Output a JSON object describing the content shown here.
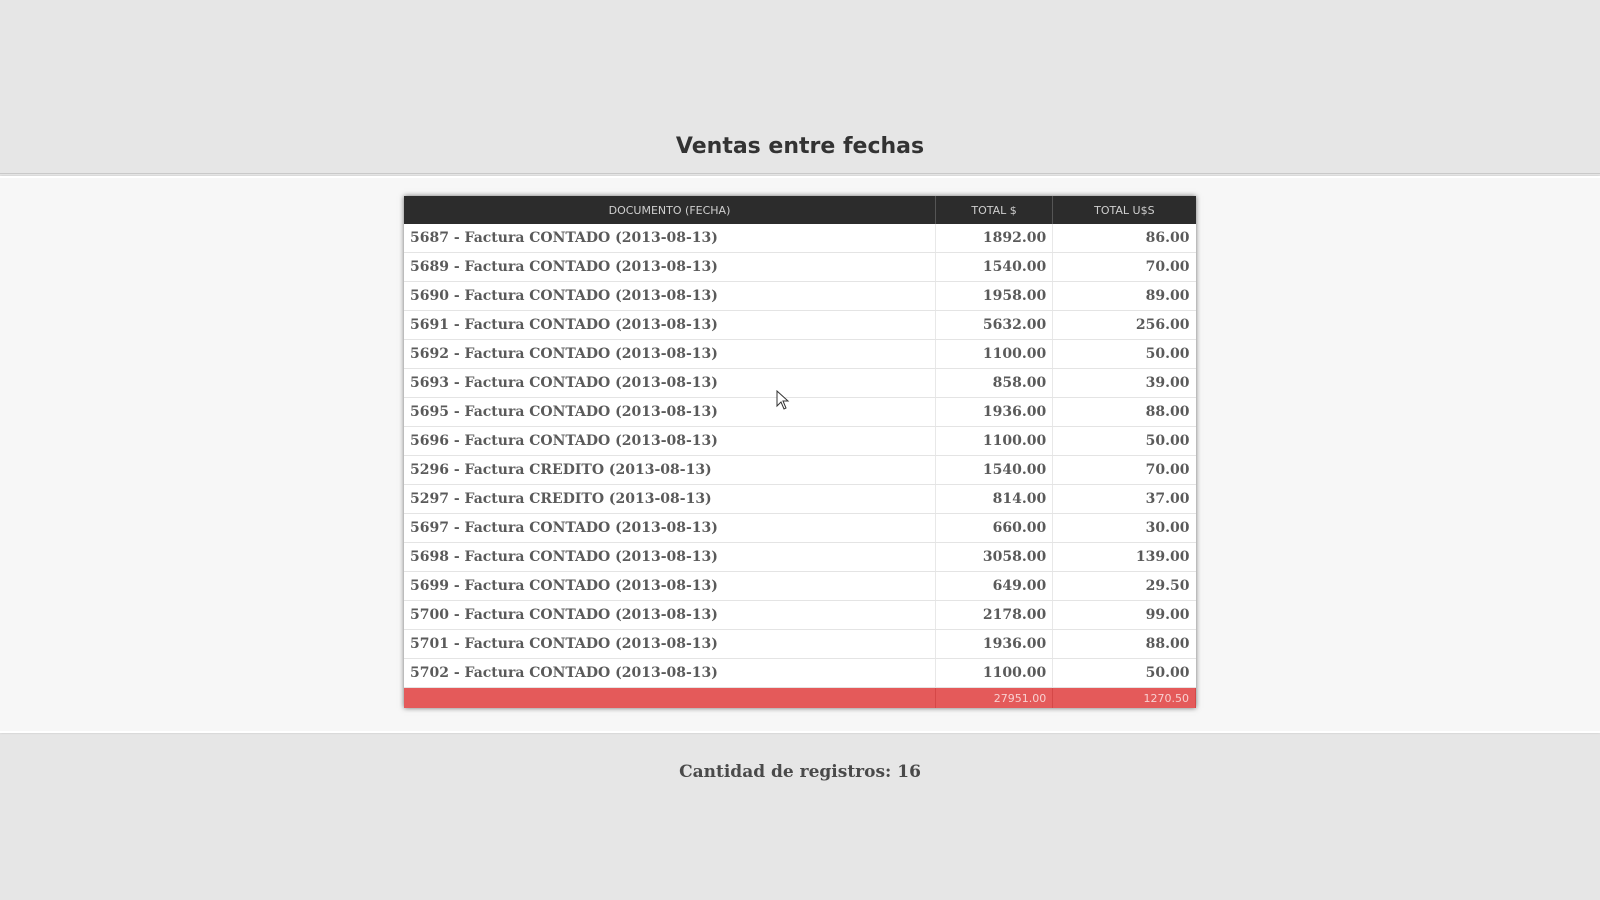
{
  "page": {
    "title": "Ventas entre fechas",
    "records_count": "Cantidad de registros: 16"
  },
  "table": {
    "headers": [
      "DOCUMENTO (FECHA)",
      "TOTAL $",
      "TOTAL U$S"
    ],
    "rows": [
      {
        "documento": "5687 - Factura CONTADO (2013-08-13)",
        "total_pesos": "1892.00",
        "total_usd": "86.00"
      },
      {
        "documento": "5689 - Factura CONTADO (2013-08-13)",
        "total_pesos": "1540.00",
        "total_usd": "70.00"
      },
      {
        "documento": "5690 - Factura CONTADO (2013-08-13)",
        "total_pesos": "1958.00",
        "total_usd": "89.00"
      },
      {
        "documento": "5691 - Factura CONTADO (2013-08-13)",
        "total_pesos": "5632.00",
        "total_usd": "256.00"
      },
      {
        "documento": "5692 - Factura CONTADO (2013-08-13)",
        "total_pesos": "1100.00",
        "total_usd": "50.00"
      },
      {
        "documento": "5693 - Factura CONTADO (2013-08-13)",
        "total_pesos": "858.00",
        "total_usd": "39.00"
      },
      {
        "documento": "5695 - Factura CONTADO (2013-08-13)",
        "total_pesos": "1936.00",
        "total_usd": "88.00"
      },
      {
        "documento": "5696 - Factura CONTADO (2013-08-13)",
        "total_pesos": "1100.00",
        "total_usd": "50.00"
      },
      {
        "documento": "5296 - Factura CREDITO (2013-08-13)",
        "total_pesos": "1540.00",
        "total_usd": "70.00"
      },
      {
        "documento": "5297 - Factura CREDITO (2013-08-13)",
        "total_pesos": "814.00",
        "total_usd": "37.00"
      },
      {
        "documento": "5697 - Factura CONTADO (2013-08-13)",
        "total_pesos": "660.00",
        "total_usd": "30.00"
      },
      {
        "documento": "5698 - Factura CONTADO (2013-08-13)",
        "total_pesos": "3058.00",
        "total_usd": "139.00"
      },
      {
        "documento": "5699 - Factura CONTADO (2013-08-13)",
        "total_pesos": "649.00",
        "total_usd": "29.50"
      },
      {
        "documento": "5700 - Factura CONTADO (2013-08-13)",
        "total_pesos": "2178.00",
        "total_usd": "99.00"
      },
      {
        "documento": "5701 - Factura CONTADO (2013-08-13)",
        "total_pesos": "1936.00",
        "total_usd": "88.00"
      },
      {
        "documento": "5702 - Factura CONTADO (2013-08-13)",
        "total_pesos": "1100.00",
        "total_usd": "50.00"
      }
    ],
    "totals": {
      "label": "",
      "total_pesos": "27951.00",
      "total_usd": "1270.50"
    }
  },
  "colors": {
    "header_bg": "#2c2c2c",
    "total_row_bg": "#e45a5a",
    "page_bg": "#e6e6e6"
  },
  "icons": {
    "cursor": "mouse-pointer-icon"
  }
}
